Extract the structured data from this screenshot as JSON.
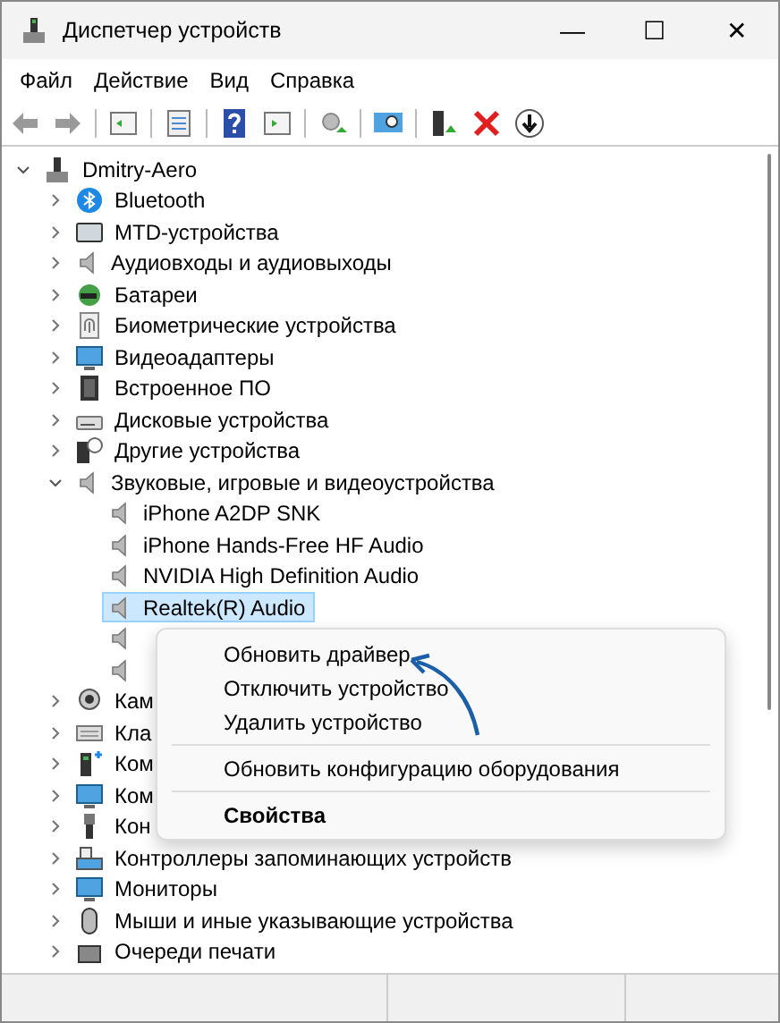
{
  "window": {
    "title": "Диспетчер устройств",
    "controls": [
      "—",
      "☐",
      "✕"
    ]
  },
  "menu_bar": [
    "Файл",
    "Действие",
    "Вид",
    "Справка"
  ],
  "tree": {
    "label": "Dmitry-Aero",
    "expanded": true,
    "selected": false,
    "children": [
      {
        "label": "Bluetooth",
        "expanded": false,
        "selected": false
      },
      {
        "label": "MTD-устройства",
        "expanded": false,
        "selected": false
      },
      {
        "label": "Аудиовходы и аудиовыходы",
        "expanded": false,
        "selected": false
      },
      {
        "label": "Батареи",
        "expanded": false,
        "selected": false
      },
      {
        "label": "Биометрические устройства",
        "expanded": false,
        "selected": false
      },
      {
        "label": "Видеоадаптеры",
        "expanded": false,
        "selected": false
      },
      {
        "label": "Встроенное ПО",
        "expanded": false,
        "selected": false
      },
      {
        "label": "Дисковые устройства",
        "expanded": false,
        "selected": false
      },
      {
        "label": "Другие устройства",
        "expanded": false,
        "selected": false
      },
      {
        "label": "Звуковые, игровые и видеоустройства",
        "expanded": true,
        "selected": false,
        "children": [
          {
            "label": "iPhone A2DP SNK",
            "selected": false
          },
          {
            "label": "iPhone Hands-Free HF Audio",
            "selected": false
          },
          {
            "label": "NVIDIA High Definition Audio",
            "selected": false
          },
          {
            "label": "Realtek(R) Audio",
            "selected": true
          },
          {
            "selected": false
          },
          {
            "selected": false
          }
        ]
      },
      {
        "label": "Кам",
        "expanded": false,
        "selected": false
      },
      {
        "label": "Кла",
        "expanded": false,
        "selected": false
      },
      {
        "label": "Ком",
        "expanded": false,
        "selected": false
      },
      {
        "label": "Ком",
        "expanded": false,
        "selected": false
      },
      {
        "label": "Кон",
        "expanded": false,
        "selected": false
      },
      {
        "label": "Контроллеры запоминающих устройств",
        "expanded": false,
        "selected": false
      },
      {
        "label": "Мониторы",
        "expanded": false,
        "selected": false
      },
      {
        "label": "Мыши и иные указывающие устройства",
        "expanded": false,
        "selected": false
      },
      {
        "label": "Очереди печати",
        "expanded": false,
        "selected": false
      }
    ]
  },
  "context_menu": [
    {
      "kind": "item",
      "label": "Обновить драйвер"
    },
    {
      "kind": "item",
      "label": "Отключить устройство"
    },
    {
      "kind": "item",
      "label": "Удалить устройство"
    },
    {
      "kind": "separator"
    },
    {
      "kind": "item",
      "label": "Обновить конфигурацию оборудования"
    },
    {
      "kind": "separator"
    },
    {
      "kind": "default",
      "label": "Свойства"
    }
  ]
}
